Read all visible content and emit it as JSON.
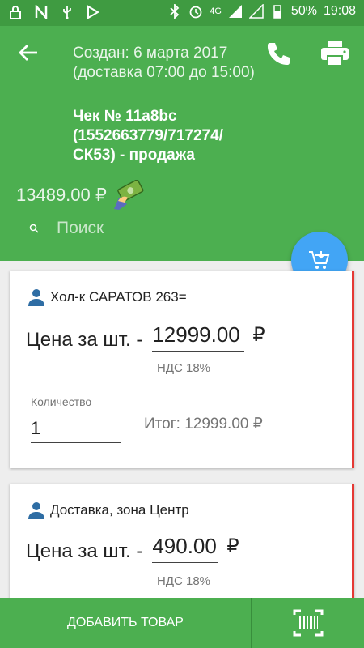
{
  "status_bar": {
    "network": "4G",
    "battery": "50%",
    "time": "19:08"
  },
  "header": {
    "title": "Создан: 6 марта 2017 (доставка 07:00 до 15:00)",
    "subtitle": "Чек № 11a8bc (1552663779/717274/СК53) - продажа",
    "total": "13489.00 ₽"
  },
  "search": {
    "placeholder": "Поиск"
  },
  "items": [
    {
      "name": "Хол-к САРАТОВ 263=",
      "price_label": "Цена за шт. -",
      "price": "12999.00",
      "currency": "₽",
      "vat": "НДС 18%",
      "qty_label": "Количество",
      "qty": "1",
      "sum": "Итог: 12999.00 ₽"
    },
    {
      "name": "Доставка, зона Центр",
      "price_label": "Цена за шт. -",
      "price": "490.00",
      "currency": "₽",
      "vat": "НДС 18%"
    }
  ],
  "bottom_bar": {
    "add_label": "ДОБАВИТЬ ТОВАР"
  },
  "colors": {
    "primary": "#4caf50",
    "status": "#3f9b41",
    "fab": "#42a5f5",
    "accent_red": "#e53935"
  },
  "icons": [
    "back-arrow-icon",
    "phone-icon",
    "printer-icon",
    "money-icon",
    "search-icon",
    "cart-add-icon",
    "person-icon",
    "barcode-icon"
  ]
}
